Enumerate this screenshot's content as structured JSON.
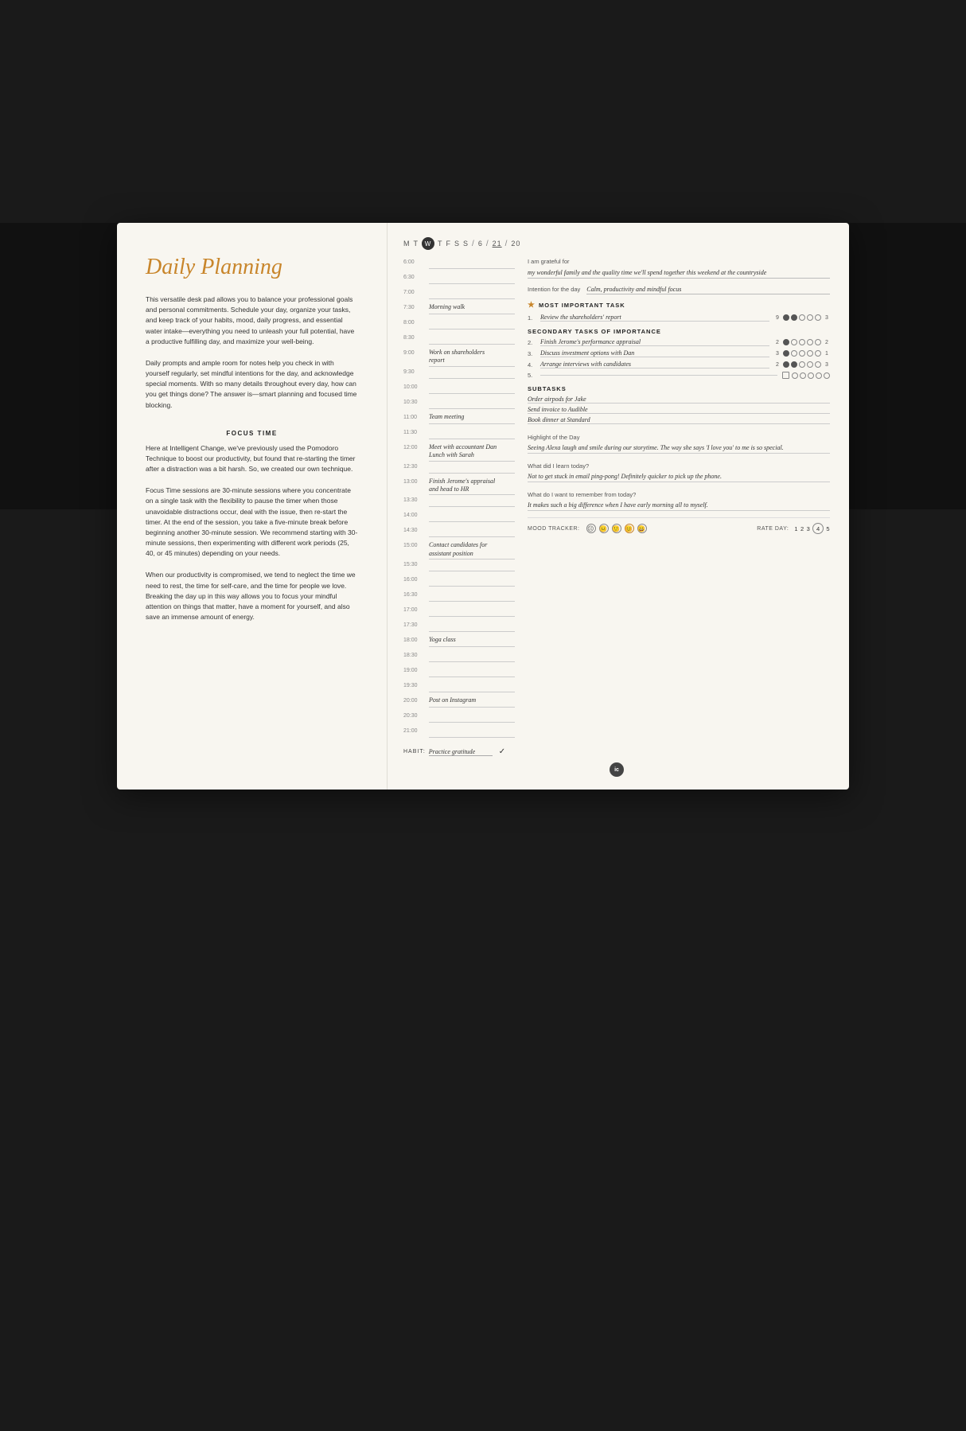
{
  "page": {
    "title": "Daily Planning",
    "background": "dark"
  },
  "left": {
    "title": "Daily Planning",
    "intro": "This versatile desk pad allows you to balance your professional goals and personal commitments. Schedule your day, organize your tasks, and keep track of your habits, mood, daily progress, and essential water intake—everything you need to unleash your full potential, have a productive fulfilling day, and maximize your well-being.",
    "body2": "Daily prompts and ample room for notes help you check in with yourself regularly, set mindful intentions for the day, and acknowledge special moments. With so many details throughout every day, how can you get things done? The answer is—smart planning and focused time blocking.",
    "section_focus": "FOCUS TIME",
    "focus_text1": "Here at Intelligent Change, we've previously used the Pomodoro Technique to boost our productivity, but found that re-starting the timer after a distraction was a bit harsh. So, we created our own technique.",
    "focus_text2": "Focus Time sessions are 30-minute sessions where you concentrate on a single task with the flexibility to pause the timer when those unavoidable distractions occur, deal with the issue, then re-start the timer. At the end of the session, you take a five-minute break before beginning another 30-minute session. We recommend starting with 30-minute sessions, then experimenting with different work periods (25, 40, or 45 minutes) depending on your needs.",
    "focus_text3": "When our productivity is compromised, we tend to neglect the time we need to rest, the time for self-care, and the time for people we love. Breaking the day up in this way allows you to focus your mindful attention on things that matter, have a moment for yourself, and also save an immense amount of energy."
  },
  "right": {
    "days": [
      "M",
      "T",
      "W",
      "T",
      "F",
      "S",
      "S"
    ],
    "active_day": "W",
    "date_month": "6",
    "date_day": "21",
    "date_year": "20",
    "gratitude_label": "I am grateful for",
    "gratitude_value": "my wonderful family and the quality time we'll spend together this weekend at the countryside",
    "intention_label": "Intention for the day",
    "intention_value": "Calm, productivity and mindful focus",
    "most_important_label": "MOST IMPORTANT TASK",
    "most_important_task": {
      "text": "Review the shareholders' report",
      "target": "9",
      "actual": "3",
      "dots_filled": 2,
      "dots_total": 5
    },
    "secondary_label": "SECONDARY TASKS OF IMPORTANCE",
    "secondary_tasks": [
      {
        "num": "2.",
        "text": "Finish Jerome's performance appraisal",
        "rating": "2",
        "actual": "2",
        "dots_filled": 1,
        "dots_empty": 4
      },
      {
        "num": "3.",
        "text": "Discuss investment options with Dan",
        "rating": "3",
        "actual": "1",
        "dots_filled": 1,
        "dots_empty": 4
      },
      {
        "num": "4.",
        "text": "Arrange interviews with candidates",
        "rating": "2",
        "actual": "3",
        "dots_filled": 2,
        "dots_empty": 3
      },
      {
        "num": "5.",
        "text": "",
        "rating": "",
        "actual": "",
        "dots_filled": 0,
        "dots_empty": 5
      }
    ],
    "subtasks_label": "SUBTASKS",
    "subtasks": [
      "Order airpods for Jake",
      "Send invoice to Audible",
      "Book dinner at Standard"
    ],
    "schedule": [
      {
        "time": "6:00",
        "text": ""
      },
      {
        "time": "6:30",
        "text": ""
      },
      {
        "time": "7:00",
        "text": ""
      },
      {
        "time": "7:30",
        "text": "Morning walk"
      },
      {
        "time": "8:00",
        "text": ""
      },
      {
        "time": "8:30",
        "text": ""
      },
      {
        "time": "9:00",
        "text": "Work on shareholders report"
      },
      {
        "time": "9:30",
        "text": ""
      },
      {
        "time": "10:00",
        "text": ""
      },
      {
        "time": "10:30",
        "text": ""
      },
      {
        "time": "11:00",
        "text": "Team meeting"
      },
      {
        "time": "11:30",
        "text": ""
      },
      {
        "time": "12:00",
        "text": "Meet with accountant Dan / Lunch with Sarah"
      },
      {
        "time": "12:30",
        "text": ""
      },
      {
        "time": "13:00",
        "text": "Finish Jerome's appraisal and head to HR"
      },
      {
        "time": "13:30",
        "text": ""
      },
      {
        "time": "14:00",
        "text": ""
      },
      {
        "time": "14:30",
        "text": ""
      },
      {
        "time": "15:00",
        "text": "Contact candidates for assistant position"
      },
      {
        "time": "15:30",
        "text": ""
      },
      {
        "time": "16:00",
        "text": ""
      },
      {
        "time": "16:30",
        "text": ""
      },
      {
        "time": "17:00",
        "text": ""
      },
      {
        "time": "17:30",
        "text": ""
      },
      {
        "time": "18:00",
        "text": "Yoga class"
      },
      {
        "time": "18:30",
        "text": ""
      },
      {
        "time": "19:00",
        "text": ""
      },
      {
        "time": "19:30",
        "text": ""
      },
      {
        "time": "20:00",
        "text": "Post on Instagram"
      },
      {
        "time": "20:30",
        "text": ""
      },
      {
        "time": "21:00",
        "text": ""
      }
    ],
    "habit_label": "HABIT:",
    "habit_value": "Practice gratitude",
    "habit_check": "✓",
    "highlight_label": "Highlight of the Day",
    "highlight_value": "Seeing Alexa laugh and smile during our storytime. The way she says 'I love you' to me is so special.",
    "learned_label": "What did I learn today?",
    "learned_value": "Not to get stuck in email ping-pong! Definitely quicker to pick up the phone.",
    "remember_label": "What do I want to remember from today?",
    "remember_value": "It makes such a big difference when I have early morning all to myself.",
    "mood_label": "MOOD TRACKER:",
    "mood_faces": [
      "😞",
      "😐",
      "🙂",
      "😊",
      "😄"
    ],
    "active_mood": 4,
    "rate_label": "RATE DAY:",
    "rate_nums": [
      "1",
      "2",
      "3",
      "4",
      "5"
    ],
    "active_rate": "4"
  }
}
